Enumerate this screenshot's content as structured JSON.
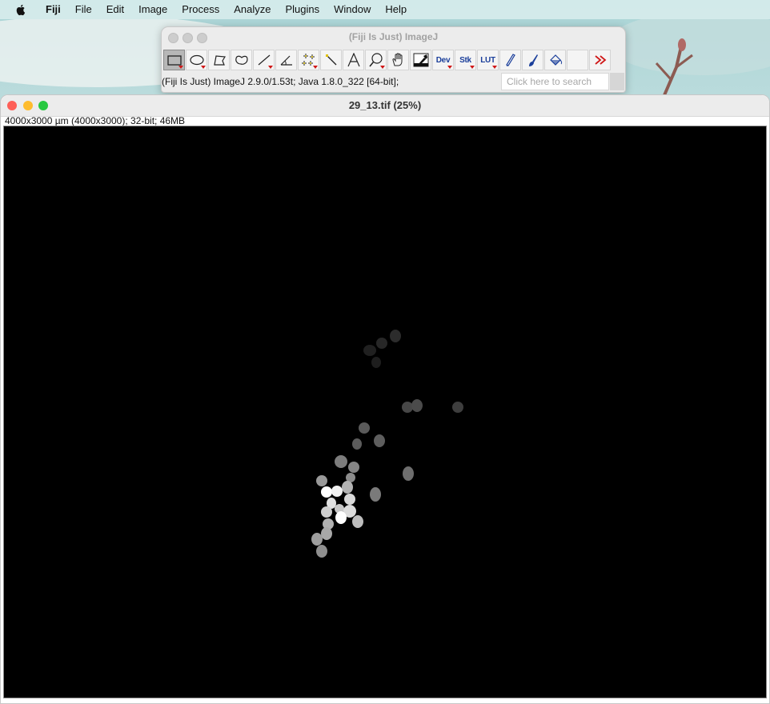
{
  "menubar": {
    "apple_icon": "apple-icon",
    "items": [
      "Fiji",
      "File",
      "Edit",
      "Image",
      "Process",
      "Analyze",
      "Plugins",
      "Window",
      "Help"
    ]
  },
  "imagej_window": {
    "title": "(Fiji Is Just) ImageJ",
    "status_text": "(Fiji Is Just) ImageJ 2.9.0/1.53t; Java 1.8.0_322 [64-bit];",
    "search_placeholder": "Click here to search",
    "tools": [
      {
        "icon": "rectangle-selection-icon",
        "selected": true
      },
      {
        "icon": "oval-selection-icon"
      },
      {
        "icon": "polygon-selection-icon"
      },
      {
        "icon": "freehand-selection-icon"
      },
      {
        "icon": "line-selection-icon"
      },
      {
        "icon": "angle-tool-icon"
      },
      {
        "icon": "multi-point-tool-icon"
      },
      {
        "icon": "wand-tool-icon"
      },
      {
        "icon": "text-tool-icon"
      },
      {
        "icon": "magnifying-glass-icon"
      },
      {
        "icon": "hand-scroll-icon"
      },
      {
        "icon": "color-picker-icon"
      },
      {
        "label": "Dev",
        "icon": "dev-menu-icon"
      },
      {
        "label": "Stk",
        "icon": "stack-menu-icon"
      },
      {
        "label": "LUT",
        "icon": "lut-menu-icon"
      },
      {
        "icon": "pencil-icon"
      },
      {
        "icon": "brush-icon"
      },
      {
        "icon": "flood-fill-icon"
      },
      {
        "icon": "empty-slot"
      },
      {
        "icon": "more-tools-icon"
      }
    ],
    "accent_color": "#d01818",
    "tool_label_color": "#1b3f9b"
  },
  "image_window": {
    "title": "29_13.tif (25%)",
    "info": "4000x3000 µm (4000x3000); 32-bit; 46MB",
    "traffic_lights": {
      "close": "#fe5f57",
      "minimize": "#febc2e",
      "zoom": "#28c840"
    }
  }
}
